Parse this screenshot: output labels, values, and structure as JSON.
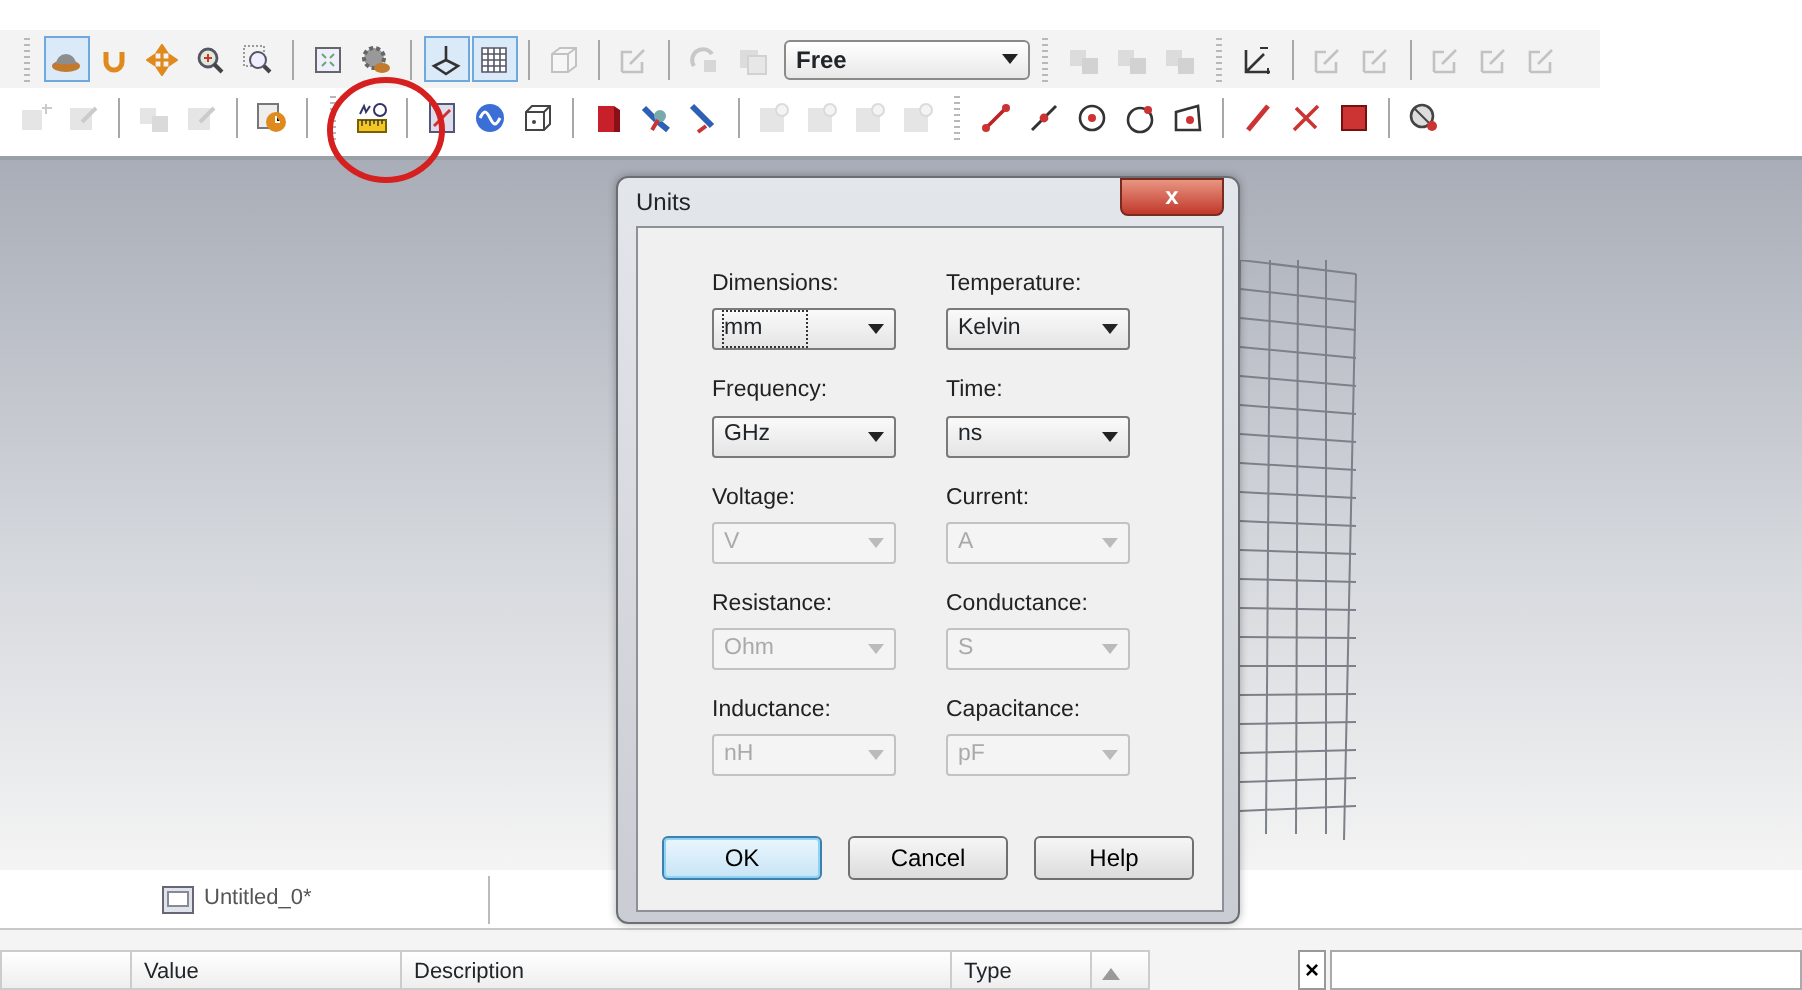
{
  "toolbars": [
    {
      "items": [
        {
          "kind": "grip"
        },
        {
          "kind": "button",
          "disabled": false,
          "pressed": true
        },
        {
          "kind": "button",
          "disabled": false,
          "pressed": false
        },
        {
          "kind": "button",
          "disabled": false,
          "pressed": false
        },
        {
          "kind": "button",
          "disabled": false,
          "pressed": false
        },
        {
          "kind": "button",
          "disabled": false,
          "pressed": false
        },
        {
          "kind": "separator"
        },
        {
          "kind": "button",
          "disabled": false,
          "pressed": false
        },
        {
          "kind": "button",
          "disabled": false,
          "pressed": false
        },
        {
          "kind": "separator"
        },
        {
          "kind": "button",
          "disabled": false,
          "pressed": true
        },
        {
          "kind": "button",
          "disabled": false,
          "pressed": true
        },
        {
          "kind": "separator"
        },
        {
          "kind": "button",
          "disabled": true,
          "pressed": false
        },
        {
          "kind": "separator"
        },
        {
          "kind": "button",
          "disabled": true,
          "pressed": false
        },
        {
          "kind": "separator"
        },
        {
          "kind": "button",
          "disabled": true,
          "pressed": false
        },
        {
          "kind": "button",
          "disabled": true,
          "pressed": false
        },
        {
          "kind": "dropdown",
          "value": "Free"
        },
        {
          "kind": "grip"
        },
        {
          "kind": "button",
          "disabled": true,
          "pressed": false
        },
        {
          "kind": "button",
          "disabled": true,
          "pressed": false
        },
        {
          "kind": "button",
          "disabled": true,
          "pressed": false
        },
        {
          "kind": "grip"
        },
        {
          "kind": "button",
          "disabled": false,
          "pressed": false
        },
        {
          "kind": "separator"
        },
        {
          "kind": "button",
          "disabled": true,
          "pressed": false
        },
        {
          "kind": "button",
          "disabled": true,
          "pressed": false
        },
        {
          "kind": "separator"
        },
        {
          "kind": "button",
          "disabled": true,
          "pressed": false
        },
        {
          "kind": "button",
          "disabled": true,
          "pressed": false
        },
        {
          "kind": "button",
          "disabled": true,
          "pressed": false
        }
      ]
    },
    {
      "items": [
        {
          "kind": "button",
          "disabled": true,
          "pressed": false
        },
        {
          "kind": "button",
          "disabled": true,
          "pressed": false
        },
        {
          "kind": "separator"
        },
        {
          "kind": "button",
          "disabled": true,
          "pressed": false
        },
        {
          "kind": "button",
          "disabled": true,
          "pressed": false
        },
        {
          "kind": "separator"
        },
        {
          "kind": "button",
          "disabled": false,
          "pressed": false
        },
        {
          "kind": "separator"
        },
        {
          "kind": "grip"
        },
        {
          "kind": "button",
          "disabled": false,
          "pressed": false
        },
        {
          "kind": "separator"
        },
        {
          "kind": "button",
          "disabled": false,
          "pressed": false
        },
        {
          "kind": "button",
          "disabled": false,
          "pressed": false
        },
        {
          "kind": "button",
          "disabled": false,
          "pressed": false
        },
        {
          "kind": "separator"
        },
        {
          "kind": "button",
          "disabled": false,
          "pressed": false
        },
        {
          "kind": "button",
          "disabled": false,
          "pressed": false
        },
        {
          "kind": "button",
          "disabled": false,
          "pressed": false
        },
        {
          "kind": "separator"
        },
        {
          "kind": "button",
          "disabled": true,
          "pressed": false
        },
        {
          "kind": "button",
          "disabled": true,
          "pressed": false
        },
        {
          "kind": "button",
          "disabled": true,
          "pressed": false
        },
        {
          "kind": "button",
          "disabled": true,
          "pressed": false
        },
        {
          "kind": "grip"
        },
        {
          "kind": "button",
          "disabled": false,
          "pressed": false
        },
        {
          "kind": "button",
          "disabled": false,
          "pressed": false
        },
        {
          "kind": "button",
          "disabled": false,
          "pressed": false
        },
        {
          "kind": "button",
          "disabled": false,
          "pressed": false
        },
        {
          "kind": "button",
          "disabled": false,
          "pressed": false
        },
        {
          "kind": "separator"
        },
        {
          "kind": "button",
          "disabled": false,
          "pressed": false
        },
        {
          "kind": "button",
          "disabled": false,
          "pressed": false
        },
        {
          "kind": "button",
          "disabled": false,
          "pressed": false
        },
        {
          "kind": "separator"
        },
        {
          "kind": "button",
          "disabled": false,
          "pressed": false
        }
      ]
    }
  ],
  "dialog": {
    "title": "Units",
    "close": "x",
    "fields": [
      {
        "label": "Dimensions:",
        "value": "mm",
        "disabled": false,
        "focused": true
      },
      {
        "label": "Temperature:",
        "value": "Kelvin",
        "disabled": false,
        "focused": false
      },
      {
        "label": "Frequency:",
        "value": "GHz",
        "disabled": false,
        "focused": false
      },
      {
        "label": "Time:",
        "value": "ns",
        "disabled": false,
        "focused": false
      },
      {
        "label": "Voltage:",
        "value": "V",
        "disabled": true,
        "focused": false
      },
      {
        "label": "Current:",
        "value": "A",
        "disabled": true,
        "focused": false
      },
      {
        "label": "Resistance:",
        "value": "Ohm",
        "disabled": true,
        "focused": false
      },
      {
        "label": "Conductance:",
        "value": "S",
        "disabled": true,
        "focused": false
      },
      {
        "label": "Inductance:",
        "value": "nH",
        "disabled": true,
        "focused": false
      },
      {
        "label": "Capacitance:",
        "value": "pF",
        "disabled": true,
        "focused": false
      }
    ],
    "buttons": [
      {
        "label": "OK",
        "default": true
      },
      {
        "label": "Cancel",
        "default": false
      },
      {
        "label": "Help",
        "default": false
      }
    ]
  },
  "tabs": [
    {
      "label": "Untitled_0*",
      "selected": true
    }
  ],
  "properties_table": {
    "columns": [
      "Value",
      "Description",
      "Type"
    ]
  },
  "side_panel": {
    "close": "×"
  }
}
